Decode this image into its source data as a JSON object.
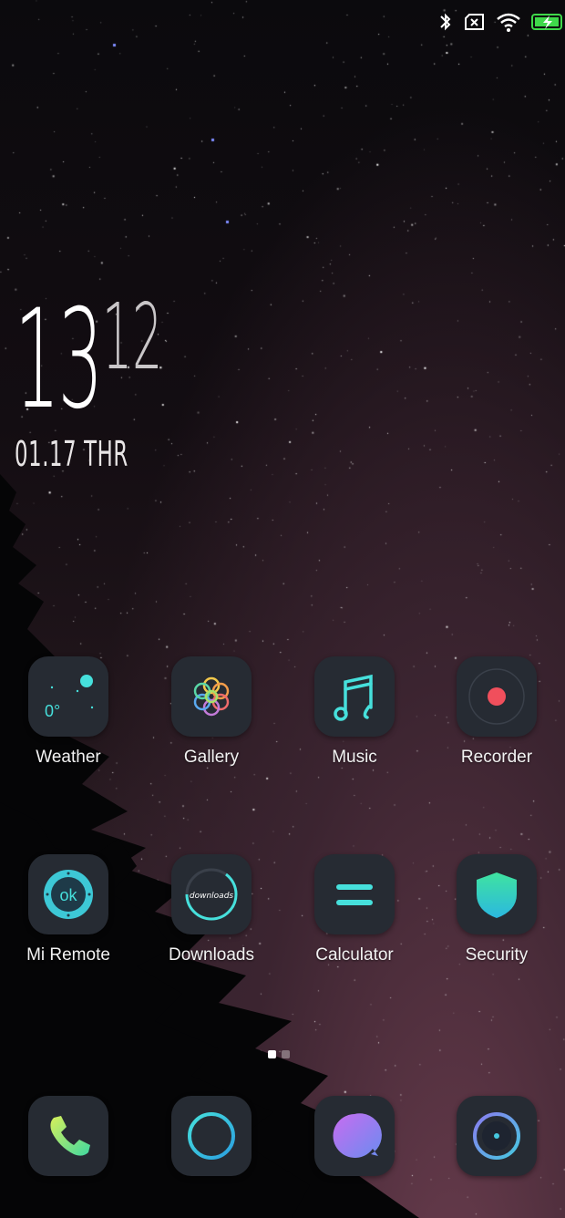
{
  "status_bar": {
    "icons": [
      "bluetooth-icon",
      "no-sim-icon",
      "wifi-icon",
      "battery-charging-icon"
    ]
  },
  "clock": {
    "hours": "13",
    "minutes": "12",
    "date": "01.17 THR"
  },
  "apps_row1": [
    {
      "label": "Weather",
      "icon": "weather-icon"
    },
    {
      "label": "Gallery",
      "icon": "gallery-icon"
    },
    {
      "label": "Music",
      "icon": "music-icon"
    },
    {
      "label": "Recorder",
      "icon": "recorder-icon"
    }
  ],
  "apps_row2": [
    {
      "label": "Mi Remote",
      "icon": "remote-icon",
      "icon_text": "ok"
    },
    {
      "label": "Downloads",
      "icon": "downloads-icon",
      "icon_text": "downloads"
    },
    {
      "label": "Calculator",
      "icon": "calculator-icon"
    },
    {
      "label": "Security",
      "icon": "security-icon"
    }
  ],
  "weather_icon_text": "0°",
  "page_indicator": {
    "pages": 2,
    "current": 1
  },
  "dock": [
    {
      "icon": "phone-icon"
    },
    {
      "icon": "browser-icon"
    },
    {
      "icon": "messages-icon"
    },
    {
      "icon": "camera-icon"
    }
  ]
}
